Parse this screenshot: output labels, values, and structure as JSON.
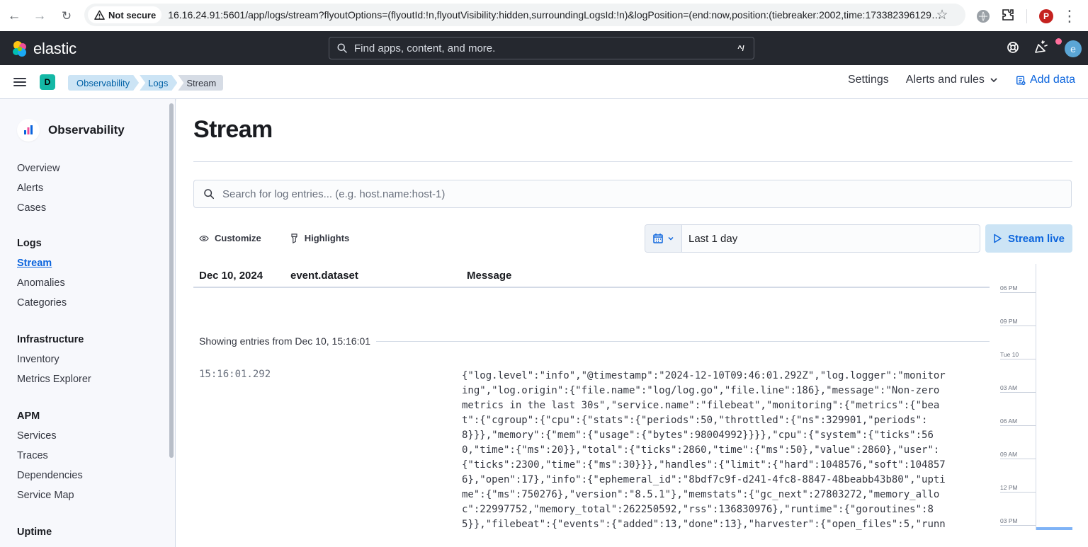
{
  "browser": {
    "security": "Not secure",
    "url": "16.16.24.91:5601/app/logs/stream?flyoutOptions=(flyoutId:!n,flyoutVisibility:hidden,surroundingLogsId:!n)&logPosition=(end:now,position:(tiebreaker:2002,time:173382396129…",
    "profile_letter": "P"
  },
  "header": {
    "brand": "elastic",
    "search_placeholder": "Find apps, content, and more.",
    "search_shortcut": "^/",
    "user_initial": "e"
  },
  "breadcrumbs": {
    "space": "D",
    "items": [
      "Observability",
      "Logs",
      "Stream"
    ],
    "settings": "Settings",
    "alerts_rules": "Alerts and rules",
    "add_data": "Add data"
  },
  "sidebar": {
    "title": "Observability",
    "items": [
      "Overview",
      "Alerts",
      "Cases"
    ],
    "logs": {
      "heading": "Logs",
      "items": [
        "Stream",
        "Anomalies",
        "Categories"
      ]
    },
    "infrastructure": {
      "heading": "Infrastructure",
      "items": [
        "Inventory",
        "Metrics Explorer"
      ]
    },
    "apm": {
      "heading": "APM",
      "items": [
        "Services",
        "Traces",
        "Dependencies",
        "Service Map"
      ]
    },
    "uptime": {
      "heading": "Uptime"
    }
  },
  "main": {
    "title": "Stream",
    "search_placeholder": "Search for log entries... (e.g. host.name:host-1)",
    "customize": "Customize",
    "highlights": "Highlights",
    "date_range": "Last 1 day",
    "stream_live": "Stream live",
    "columns": {
      "date": "Dec 10, 2024",
      "dataset": "event.dataset",
      "message": "Message"
    },
    "entries_from": "Showing entries from Dec 10, 15:16:01",
    "log_time": "15:16:01.292",
    "log_message": "{\"log.level\":\"info\",\"@timestamp\":\"2024-12-10T09:46:01.292Z\",\"log.logger\":\"monitor\ning\",\"log.origin\":{\"file.name\":\"log/log.go\",\"file.line\":186},\"message\":\"Non-zero\nmetrics in the last 30s\",\"service.name\":\"filebeat\",\"monitoring\":{\"metrics\":{\"bea\nt\":{\"cgroup\":{\"cpu\":{\"stats\":{\"periods\":50,\"throttled\":{\"ns\":329901,\"periods\":\n8}}},\"memory\":{\"mem\":{\"usage\":{\"bytes\":98004992}}}},\"cpu\":{\"system\":{\"ticks\":56\n0,\"time\":{\"ms\":20}},\"total\":{\"ticks\":2860,\"time\":{\"ms\":50},\"value\":2860},\"user\":\n{\"ticks\":2300,\"time\":{\"ms\":30}}},\"handles\":{\"limit\":{\"hard\":1048576,\"soft\":104857\n6},\"open\":17},\"info\":{\"ephemeral_id\":\"8bdf7c9f-d241-4fc8-8847-48beabb43b80\",\"upti\nme\":{\"ms\":750276},\"version\":\"8.5.1\"},\"memstats\":{\"gc_next\":27803272,\"memory_allo\nc\":22997752,\"memory_total\":262250592,\"rss\":136830976},\"runtime\":{\"goroutines\":8\n5}},\"filebeat\":{\"events\":{\"added\":13,\"done\":13},\"harvester\":{\"open_files\":5,\"runn",
    "minimap_ticks": [
      "06 PM",
      "09 PM",
      "Tue 10",
      "03 AM",
      "06 AM",
      "09 AM",
      "12 PM",
      "03 PM"
    ]
  },
  "colors": {
    "accent": "#0b64dd",
    "header": "#25282f",
    "space_badge": "#14b8a6",
    "breadcrumb": "#cce4f5"
  }
}
